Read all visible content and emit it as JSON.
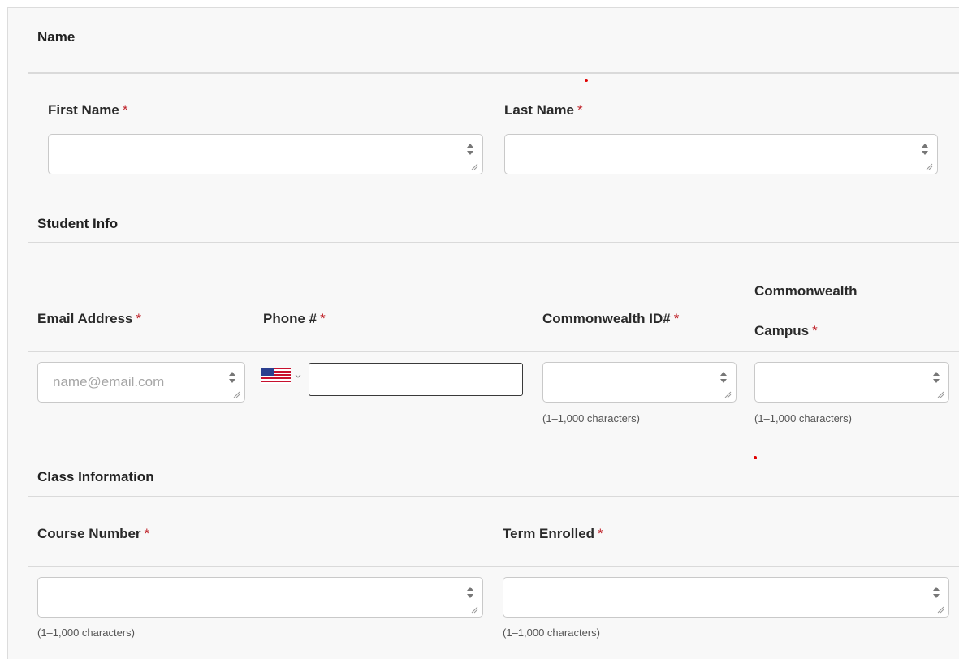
{
  "sections": {
    "name": {
      "title": "Name"
    },
    "student_info": {
      "title": "Student Info"
    },
    "class_info": {
      "title": "Class Information"
    }
  },
  "required_marker": "*",
  "fields": {
    "first_name": {
      "label": "First Name",
      "value": ""
    },
    "last_name": {
      "label": "Last Name",
      "value": ""
    },
    "email": {
      "label": "Email Address",
      "placeholder": "name@email.com",
      "value": ""
    },
    "phone": {
      "label": "Phone #",
      "country": "US",
      "value": ""
    },
    "commonwealth_id": {
      "label": "Commonwealth ID#",
      "value": "",
      "hint": "(1–1,000 characters)"
    },
    "campus": {
      "label_line1": "Commonwealth",
      "label_line2": "Campus",
      "value": "",
      "hint": "(1–1,000 characters)"
    },
    "course_number": {
      "label": "Course Number",
      "value": "",
      "hint": "(1–1,000 characters)"
    },
    "term_enrolled": {
      "label": "Term Enrolled",
      "value": "",
      "hint": "(1–1,000 characters)"
    }
  },
  "icons": {
    "spinner": "spinner-arrows-icon",
    "resize": "resize-grip-icon",
    "flag": "us-flag-icon",
    "dropdown": "chevron-down-icon"
  },
  "colors": {
    "required": "#c0262d",
    "background": "#f8f8f8",
    "rule": "#dadada"
  }
}
